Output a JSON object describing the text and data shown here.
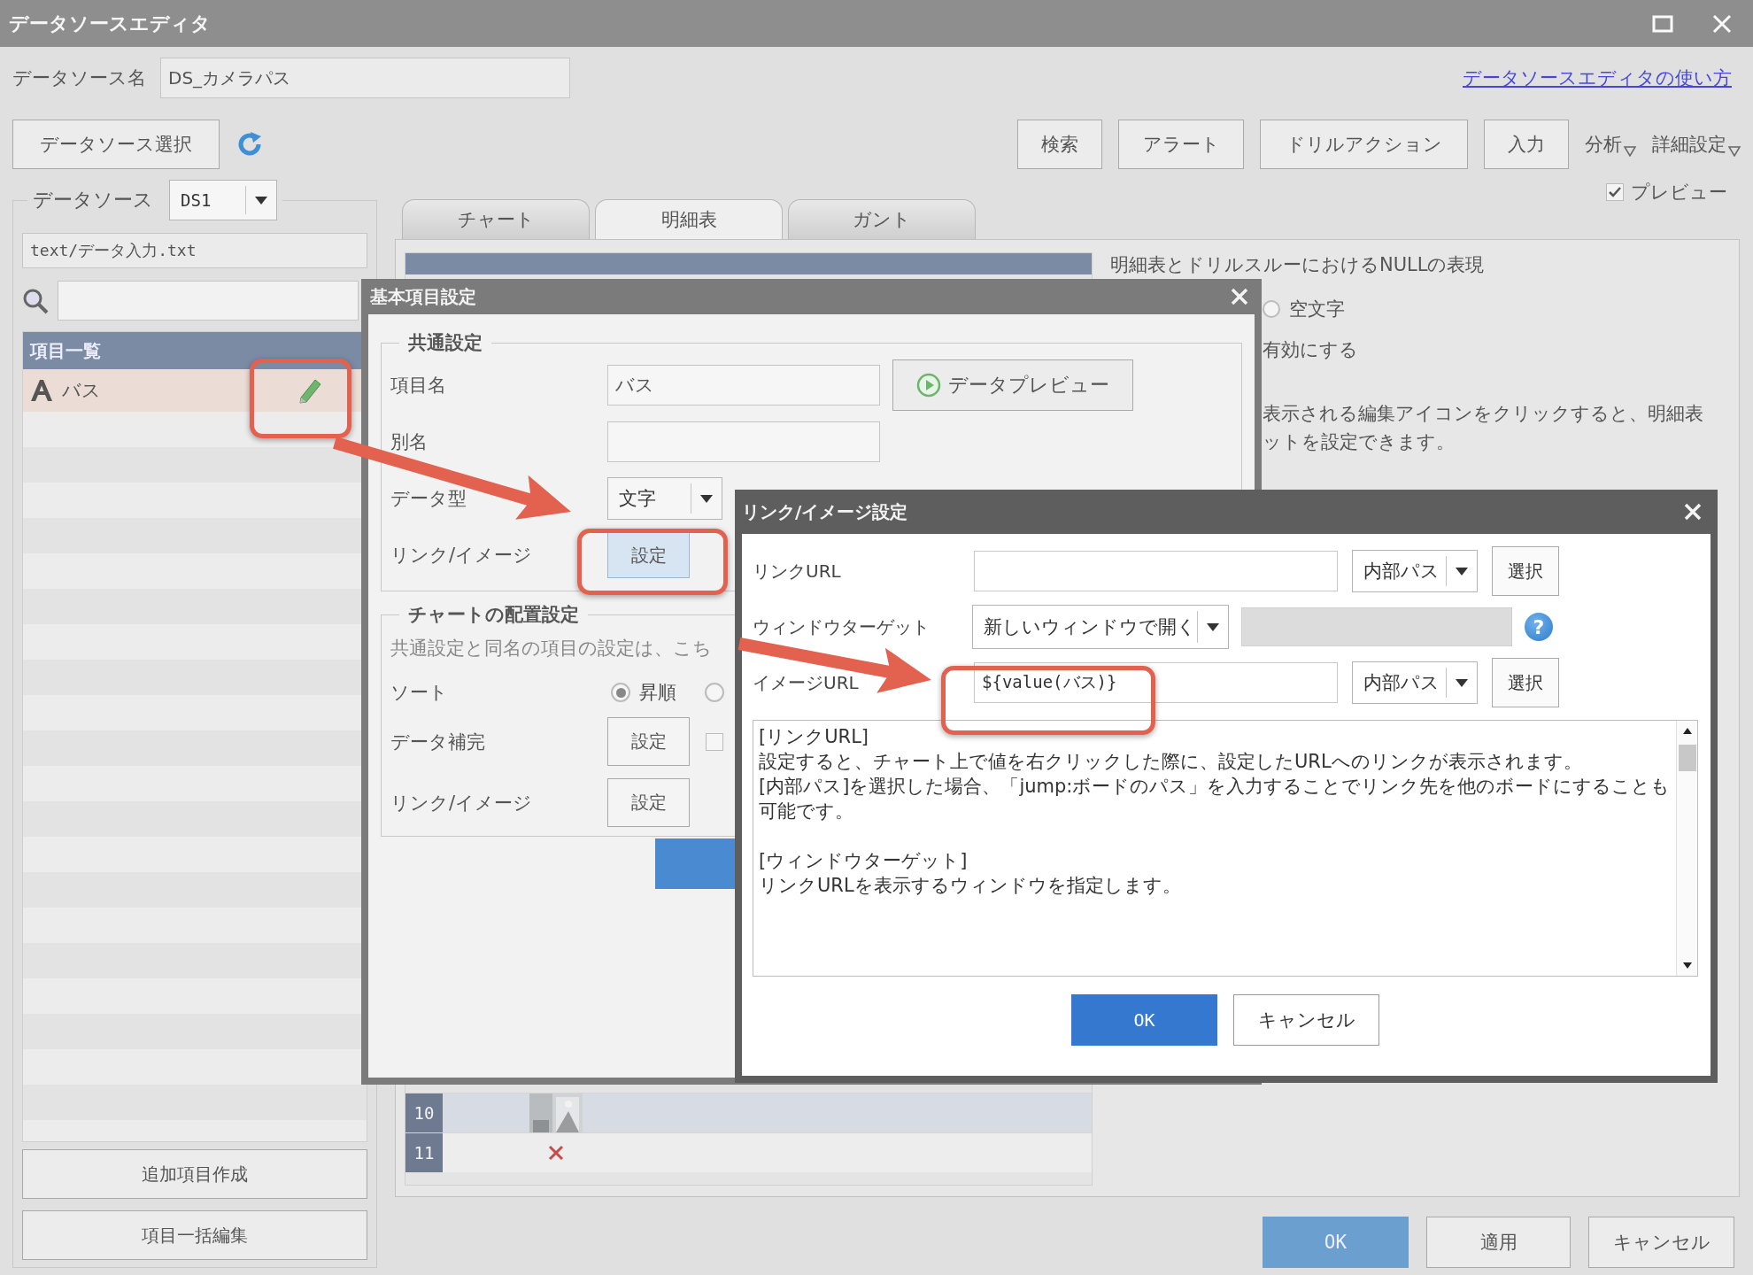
{
  "window": {
    "title": "データソースエディタ"
  },
  "header": {
    "name_label": "データソース名",
    "name_value": "DS_カメラパス",
    "help_link": "データソースエディタの使い方"
  },
  "toolbar": {
    "select_button": "データソース選択",
    "buttons": [
      {
        "label": "検索",
        "kind": "button"
      },
      {
        "label": "アラート",
        "kind": "button"
      },
      {
        "label": "ドリルアクション",
        "kind": "button"
      },
      {
        "label": "入力",
        "kind": "button"
      },
      {
        "label": "分析",
        "kind": "menu"
      },
      {
        "label": "詳細設定",
        "kind": "menu"
      }
    ]
  },
  "preview": {
    "label": "プレビュー",
    "checked": true
  },
  "sidebar": {
    "legend": "データソース",
    "source": "DS1",
    "path": "text/データ入力.txt",
    "list_header": "項目一覧",
    "items": [
      {
        "label": "バス",
        "selected": true
      }
    ],
    "buttons": [
      "追加項目作成",
      "項目一括編集"
    ]
  },
  "tabs": [
    {
      "label": "チャート",
      "selected": false
    },
    {
      "label": "明細表",
      "selected": true
    },
    {
      "label": "ガント",
      "selected": false
    }
  ],
  "detail": {
    "rows": [
      {
        "number": "10",
        "kind": "picture"
      },
      {
        "number": "11",
        "kind": "missing"
      }
    ],
    "null_title": "明細表とドリルスルーにおけるNULLの表現",
    "null_option": {
      "label": "空文字",
      "selected": false
    },
    "enable_text": "有効にする",
    "note_lines": [
      "表示される編集アイコンをクリックすると、明細表",
      "ットを設定できます。"
    ]
  },
  "footer_buttons": [
    {
      "label": "OK",
      "kind": "primary"
    },
    {
      "label": "適用",
      "kind": "normal"
    },
    {
      "label": "キャンセル",
      "kind": "normal"
    }
  ],
  "item_dialog": {
    "title": "基本項目設定",
    "common": {
      "legend": "共通設定",
      "name_label": "項目名",
      "name_value": "バス",
      "alias_label": "別名",
      "preview_button": "データプレビュー",
      "type_label": "データ型",
      "type_value": "文字",
      "link_label": "リンク/イメージ",
      "link_button": "設定",
      "link_button_highlighted": true
    },
    "chart": {
      "legend": "チャートの配置設定",
      "note": "共通設定と同名の項目の設定は、こち",
      "sort_label": "ソート",
      "sort_options": [
        {
          "label": "昇順",
          "selected": true
        },
        {
          "selected": false
        }
      ],
      "complement_label": "データ補完",
      "complement_button": "設定",
      "complement_checked": false,
      "link_label": "リンク/イメージ",
      "link_button": "設定"
    }
  },
  "link_dialog": {
    "title": "リンク/イメージ設定",
    "rows": [
      {
        "kind": "url",
        "label": "リンクURL",
        "mode": "内部パス",
        "button": "選択"
      },
      {
        "kind": "target",
        "label": "ウィンドウターゲット",
        "value": "新しいウィンドウで開く",
        "help": "?"
      },
      {
        "kind": "url",
        "label": "イメージURL",
        "value": "${value(バス)}",
        "mode": "内部パス",
        "button": "選択"
      }
    ],
    "help_paragraphs": [
      [
        "[リンクURL]",
        "設定すると、チャート上で値を右クリックした際に、設定したURLへのリンクが表示されます。",
        "[内部パス]を選択した場合、「jump:ボードのパス」を入力することでリンク先を他のボードにすることも可能です。"
      ],
      [
        "[ウィンドウターゲット]",
        "リンクURLを表示するウィンドウを指定します。"
      ]
    ],
    "buttons": [
      {
        "label": "OK",
        "kind": "primary"
      },
      {
        "label": "キャンセル",
        "kind": "normal"
      }
    ]
  }
}
